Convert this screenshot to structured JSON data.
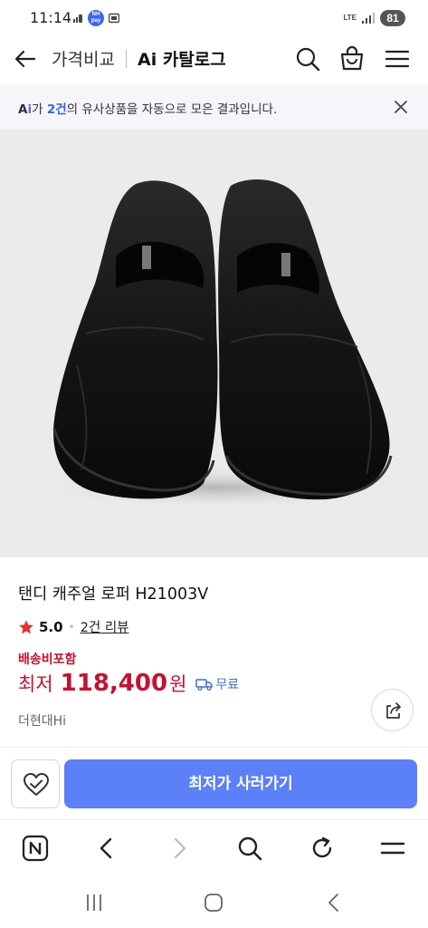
{
  "status_bar": {
    "time": "11:14",
    "np_badge_top": "NH",
    "np_badge_bottom": "pay",
    "network": "LTE",
    "battery": "81"
  },
  "header": {
    "sub_title": "가격비교",
    "title": "Ai 카탈로그"
  },
  "notice": {
    "prefix": "가",
    "highlight": "2건",
    "suffix": "의 유사상품을 자동으로 모은 결과입니다."
  },
  "product": {
    "name": "탠디 캐주얼 로퍼 H21003V",
    "rating": "5.0",
    "reviews": "2건 리뷰",
    "shipping_note": "배송비포함",
    "price_label": "최저",
    "price": "118,400",
    "price_unit": "원",
    "free_shipping": "무료",
    "seller": "더현대Hi"
  },
  "actions": {
    "buy_label": "최저가 사러가기"
  },
  "colors": {
    "accent_blue": "#5b80f7",
    "price_red": "#c8102e",
    "notice_bg": "#f7f4fa",
    "star": "#e8322e"
  }
}
